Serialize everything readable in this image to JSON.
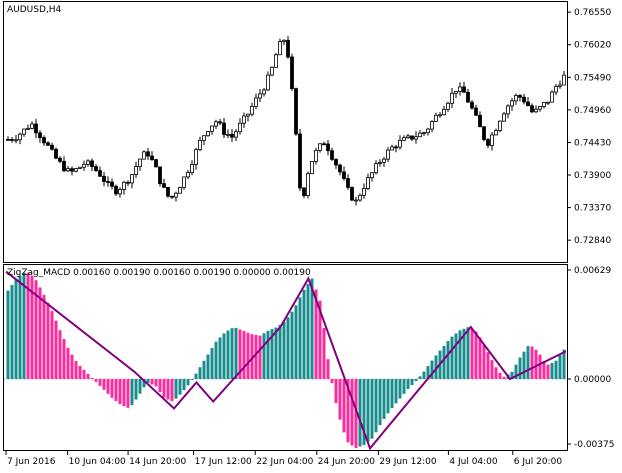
{
  "main_chart": {
    "label": "AUDUSD,H4",
    "price_ticks": [
      "0.76550",
      "0.76020",
      "0.75490",
      "0.74960",
      "0.74430",
      "0.73900",
      "0.73370",
      "0.72840"
    ]
  },
  "indicator": {
    "label": "ZigZag_MACD 0.00160 0.00190 0.00160 0.00190 0.00000 0.00190",
    "value_ticks": [
      "0.00629",
      "0.00000",
      "-0.00375"
    ]
  },
  "time_axis": [
    "7 Jun 2016",
    "10 Jun 04:00",
    "14 Jun 20:00",
    "17 Jun 12:00",
    "22 Jun 04:00",
    "24 Jun 20:00",
    "29 Jun 12:00",
    "4 Jul 04:00",
    "6 Jul 20:00"
  ],
  "colors": {
    "candle": "#000000",
    "zigzag": "#800080",
    "histogram_up": "#008080",
    "histogram_down": "#ff1493",
    "zero_line": "#c0c0c0"
  },
  "chart_data": [
    {
      "type": "candlestick",
      "title": "AUDUSD,H4",
      "y_ticks": [
        0.7655,
        0.7602,
        0.7549,
        0.7496,
        0.7443,
        0.739,
        0.7337,
        0.7284
      ],
      "ylim": [
        0.7255,
        0.7665
      ],
      "x_tick_labels": [
        "7 Jun 2016",
        "10 Jun 04:00",
        "14 Jun 20:00",
        "17 Jun 12:00",
        "22 Jun 04:00",
        "24 Jun 20:00",
        "29 Jun 12:00",
        "4 Jul 04:00",
        "6 Jul 20:00"
      ],
      "close_path": [
        0.7448,
        0.7452,
        0.7462,
        0.7474,
        0.7458,
        0.744,
        0.742,
        0.7405,
        0.7393,
        0.74,
        0.741,
        0.7403,
        0.739,
        0.7372,
        0.7365,
        0.7375,
        0.739,
        0.7415,
        0.7428,
        0.7405,
        0.737,
        0.735,
        0.7368,
        0.739,
        0.7418,
        0.7448,
        0.7468,
        0.7478,
        0.746,
        0.7452,
        0.747,
        0.7488,
        0.751,
        0.753,
        0.7555,
        0.7598,
        0.7615,
        0.75,
        0.734,
        0.7405,
        0.743,
        0.7445,
        0.742,
        0.7395,
        0.7365,
        0.7345,
        0.737,
        0.739,
        0.741,
        0.7425,
        0.7438,
        0.7445,
        0.745,
        0.7455,
        0.746,
        0.7478,
        0.7495,
        0.7512,
        0.753,
        0.7525,
        0.75,
        0.747,
        0.744,
        0.7462,
        0.749,
        0.7508,
        0.752,
        0.751,
        0.749,
        0.75,
        0.7512,
        0.7535,
        0.755
      ]
    },
    {
      "type": "bar",
      "title": "ZigZag_MACD",
      "y_ticks": [
        0.00629,
        0.0,
        -0.00375
      ],
      "ylim": [
        -0.00375,
        0.00629
      ],
      "histogram_path": [
        0.0051,
        0.0058,
        0.0062,
        0.0059,
        0.005,
        0.004,
        0.0028,
        0.0017,
        0.0009,
        0.0004,
        -0.0001,
        -0.0006,
        -0.0011,
        -0.0015,
        -0.0017,
        -0.001,
        -0.0002,
        -0.0004,
        -0.0011,
        -0.0013,
        -0.0008,
        -0.0002,
        0.0006,
        0.0014,
        0.0022,
        0.0027,
        0.003,
        0.0028,
        0.0026,
        0.0025,
        0.0028,
        0.003,
        0.0034,
        0.0041,
        0.0051,
        0.0058,
        0.0044,
        0.0005,
        -0.002,
        -0.0036,
        -0.004,
        -0.0038,
        -0.0034,
        -0.0025,
        -0.0018,
        -0.0012,
        -0.0006,
        -0.0001,
        0.0005,
        0.0012,
        0.0018,
        0.0024,
        0.0028,
        0.003,
        0.0027,
        0.0018,
        0.0008,
        0.0001,
        0.0004,
        0.0013,
        0.002,
        0.0016,
        0.0008,
        0.001,
        0.0017
      ],
      "zigzag_path": [
        0.0062,
        0.0004,
        -0.0017,
        -0.0002,
        -0.0013,
        0.003,
        0.0058,
        -0.004,
        0.003,
        0.0,
        0.0016
      ]
    }
  ]
}
